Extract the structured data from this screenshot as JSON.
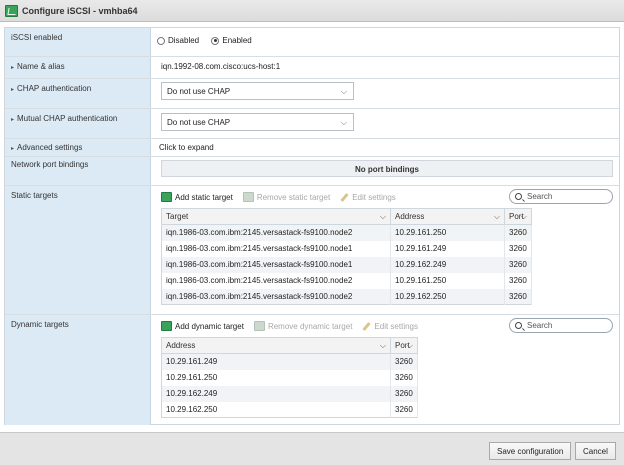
{
  "window": {
    "title": "Configure iSCSI - vmhba64"
  },
  "iscsi_enabled": {
    "label": "iSCSI enabled",
    "disabled": "Disabled",
    "enabled": "Enabled",
    "selected": "Enabled"
  },
  "name_alias": {
    "label": "Name & alias",
    "value": "iqn.1992-08.com.cisco:ucs-host:1"
  },
  "chap": {
    "label": "CHAP authentication",
    "value": "Do not use CHAP"
  },
  "mutual_chap": {
    "label": "Mutual CHAP authentication",
    "value": "Do not use CHAP"
  },
  "advanced": {
    "label": "Advanced settings",
    "value": "Click to expand"
  },
  "port_bindings": {
    "label": "Network port bindings",
    "value": "No port bindings"
  },
  "static_targets": {
    "label": "Static targets",
    "add": "Add static target",
    "remove": "Remove static target",
    "edit": "Edit settings",
    "search_placeholder": "Search",
    "columns": [
      "Target",
      "Address",
      "Port"
    ],
    "rows": [
      [
        "iqn.1986-03.com.ibm:2145.versastack-fs9100.node2",
        "10.29.161.250",
        "3260"
      ],
      [
        "iqn.1986-03.com.ibm:2145.versastack-fs9100.node1",
        "10.29.161.249",
        "3260"
      ],
      [
        "iqn.1986-03.com.ibm:2145.versastack-fs9100.node1",
        "10.29.162.249",
        "3260"
      ],
      [
        "iqn.1986-03.com.ibm:2145.versastack-fs9100.node2",
        "10.29.161.250",
        "3260"
      ],
      [
        "iqn.1986-03.com.ibm:2145.versastack-fs9100.node2",
        "10.29.162.250",
        "3260"
      ]
    ]
  },
  "dynamic_targets": {
    "label": "Dynamic targets",
    "add": "Add dynamic target",
    "remove": "Remove dynamic target",
    "edit": "Edit settings",
    "search_placeholder": "Search",
    "columns": [
      "Address",
      "Port"
    ],
    "rows": [
      [
        "10.29.161.249",
        "3260"
      ],
      [
        "10.29.161.250",
        "3260"
      ],
      [
        "10.29.162.249",
        "3260"
      ],
      [
        "10.29.162.250",
        "3260"
      ]
    ]
  },
  "footer": {
    "save": "Save configuration",
    "cancel": "Cancel"
  }
}
